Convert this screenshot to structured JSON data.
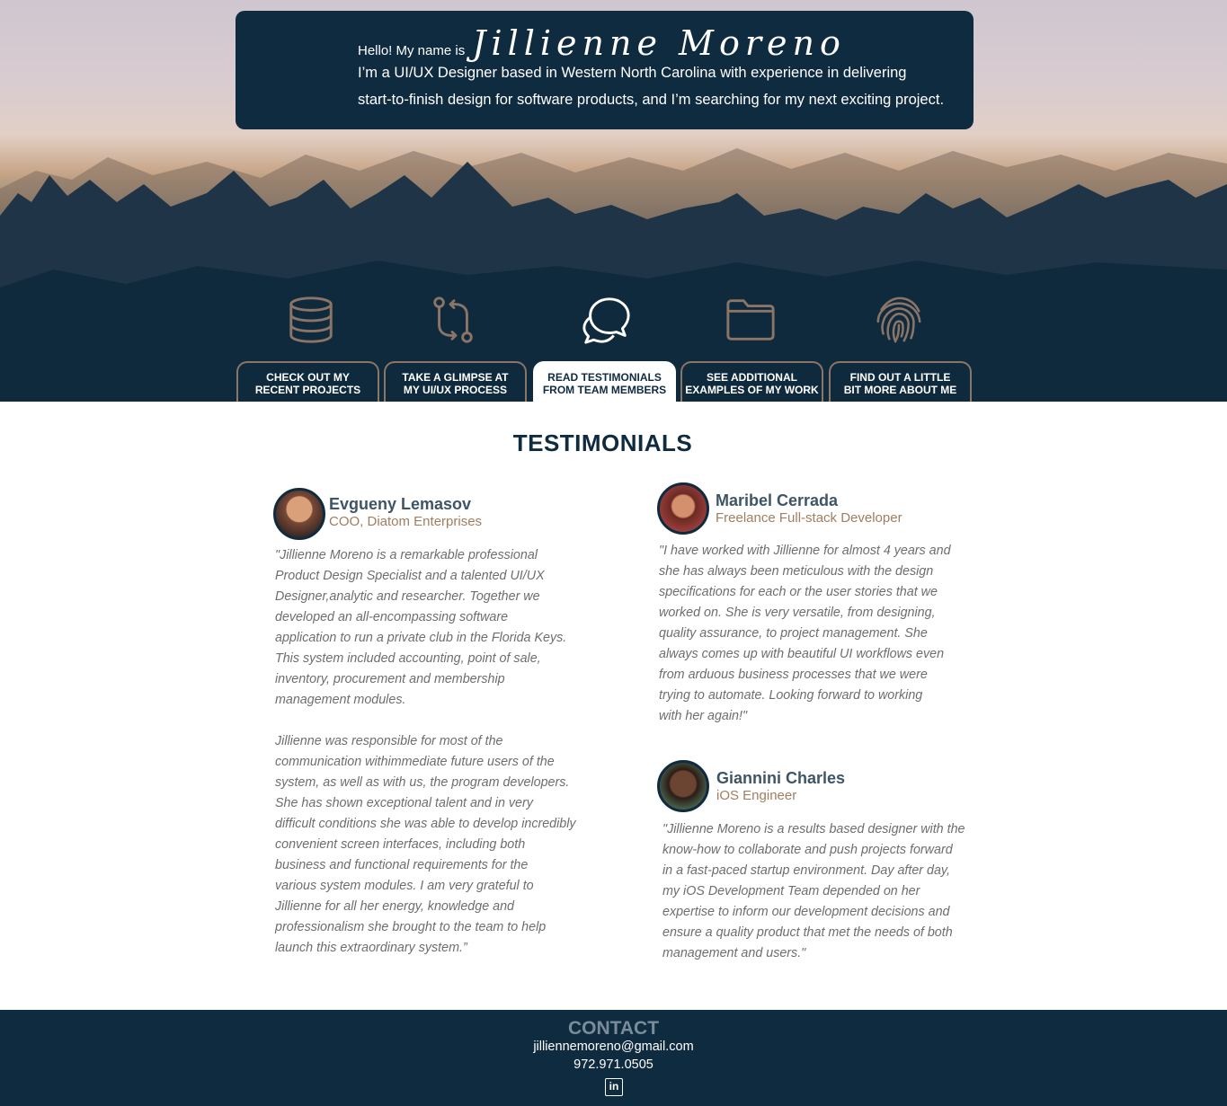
{
  "intro": {
    "greeting": "Hello!  My name is",
    "name": "Jillienne Moreno",
    "line1": "I’m a UI/UX Designer based in Western North Carolina with experience in delivering",
    "line2": "start-to-finish design for software products, and I’m searching for my next exciting project."
  },
  "nav": {
    "icons": [
      "database-icon",
      "git-compare-icon",
      "chat-bubbles-icon",
      "folder-icon",
      "fingerprint-icon"
    ],
    "tabs": [
      {
        "line1": "CHECK OUT MY",
        "line2": "RECENT PROJECTS"
      },
      {
        "line1": "TAKE A GLIMPSE AT",
        "line2": "MY UI/UX PROCESS"
      },
      {
        "line1": "READ TESTIMONIALS",
        "line2": "FROM TEAM MEMBERS"
      },
      {
        "line1": "SEE ADDITIONAL",
        "line2": "EXAMPLES OF MY WORK"
      },
      {
        "line1": "FIND OUT A LITTLE",
        "line2": "BIT MORE  ABOUT ME"
      }
    ],
    "active_tab": "READ TESTIMONIALS FROM TEAM MEMBERS"
  },
  "testimonials": {
    "title": "TESTIMONIALS",
    "items": [
      {
        "name": "Evgueny Lemasov",
        "role": "COO, Diatom Enterprises",
        "quote_lines": [
          "\"Jillienne Moreno is a remarkable professional",
          "Product Design Specialist and a talented UI/UX",
          "Designer,analytic and researcher. Together we",
          "developed an all-encompassing software",
          "application to run a private club in the Florida Keys.",
          "This system included accounting, point of sale,",
          "inventory, procurement and membership",
          "management modules.",
          "",
          "Jillienne was responsible for most of the",
          "communication withimmediate future users of the",
          "system, as well as with us, the program developers.",
          "She has shown exceptional talent and in very",
          "difficult conditions she was able to develop incredibly",
          "convenient screen interfaces, including both",
          "business and functional requirements for the",
          "various system modules. I am very grateful to",
          "Jillienne for all her energy, knowledge and",
          "professionalism she brought to the team to help",
          "launch this extraordinary system.”"
        ]
      },
      {
        "name": "Maribel Cerrada",
        "role": "Freelance Full-stack Developer",
        "quote_lines": [
          "\"I have worked with Jillienne for almost 4 years and",
          "she has always been meticulous with the design",
          "specifications for each or the user stories that we",
          "worked on. She is very versatile, from designing,",
          "quality assurance, to project management. She",
          "always comes up with beautiful UI workflows even",
          "from arduous business processes that we were",
          "trying to automate. Looking forward to working",
          "with her again!\""
        ]
      },
      {
        "name": "Giannini Charles",
        "role": "iOS Engineer",
        "quote_lines": [
          "\"Jillienne Moreno is a results based designer with the",
          "know-how to collaborate and push projects forward",
          "in a fast-paced startup environment. Day after day,",
          "my iOS Development Team depended on her",
          "expertise to inform our development decisions and",
          "ensure a quality product that met the needs of both",
          "management and users.\""
        ]
      }
    ]
  },
  "footer": {
    "title": "CONTACT",
    "email": "jilliennemoreno@gmail.com",
    "phone": "972.971.0505",
    "linkedin_label": "in"
  },
  "colors": {
    "navy": "#0f2b40",
    "accent_brown": "#8a7566",
    "role_text": "#a07e5e"
  }
}
